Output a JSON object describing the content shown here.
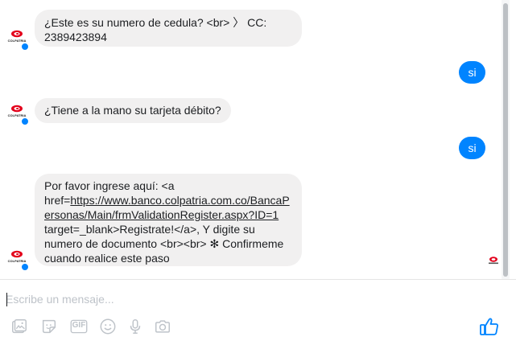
{
  "messages": [
    {
      "direction": "in",
      "text_line1": "¿Este es su numero de cedula?  <br> 〉 CC:",
      "text_line2": "2389423894"
    },
    {
      "direction": "out",
      "text": "si"
    },
    {
      "direction": "in",
      "text": "¿Tiene a la mano su tarjeta débito?"
    },
    {
      "direction": "out",
      "text": "si"
    },
    {
      "direction": "in",
      "line1": "Por favor ingrese aquí: <a",
      "line2_prefix": "href=",
      "link_part1": "https://www.banco.colpatria.com.co/BancaP",
      "link_part2": "ersonas/Main/frmValidationRegister.aspx?ID=1",
      "line4": "target=_blank>Registrate!</a>, Y digite su",
      "line5": "numero de documento <br><br> ✻ Confirmeme",
      "line6": "cuando realice este paso"
    }
  ],
  "sender": {
    "brand_text": "COLPATRIA",
    "logo_color": "#e3001b"
  },
  "composer": {
    "placeholder": "Escribe un mensaje..."
  },
  "toolbar": {
    "icons": [
      "photo-icon",
      "sticker-icon",
      "gif-icon",
      "emoji-icon",
      "microphone-icon",
      "camera-icon",
      "thumbs-up-icon"
    ],
    "gif_label": "GIF"
  },
  "colors": {
    "accent": "#0084ff",
    "incoming_bubble": "#f1f0f0",
    "icon_gray": "#bec3c9"
  }
}
